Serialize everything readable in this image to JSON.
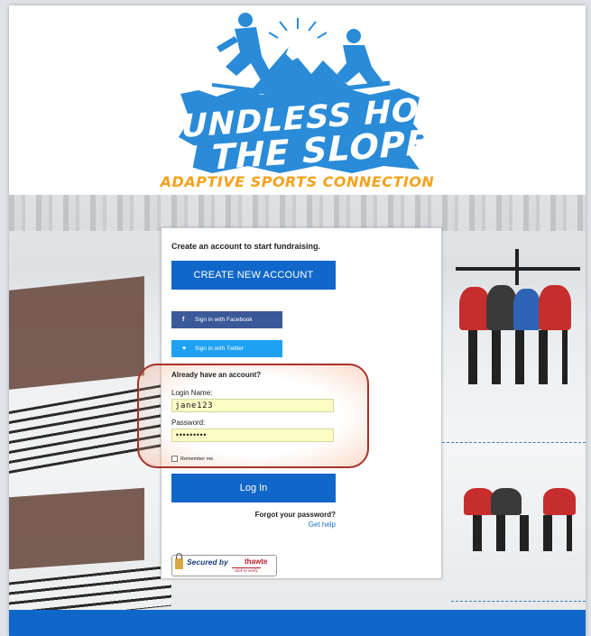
{
  "brand": {
    "logo_line1": "BOUNDLESS HOPE",
    "logo_line2": "ON THE SLOPES",
    "tagline": "ADAPTIVE SPORTS CONNECTION",
    "logo_blue": "#2a8bd8",
    "tagline_orange": "#f5a21d"
  },
  "panel": {
    "create_heading": "Create an account to start fundraising.",
    "create_button": "CREATE NEW ACCOUNT",
    "facebook_icon": "f",
    "facebook_button": "Sign in with Facebook",
    "twitter_icon": "♥",
    "twitter_button": "Sign in with Twitter",
    "login_heading": "Already have an account?",
    "login_label": "Login Name:",
    "login_value": "jane123",
    "password_label": "Password:",
    "password_value": "•••••••••",
    "remember_label": "Remember me",
    "login_button": "Log In",
    "forgot_text": "Forgot your password?",
    "help_link": "Get help",
    "accent_color": "#1167c9"
  },
  "seal": {
    "secured_by": "Secured by",
    "brand": "thawte",
    "verify": "click to verify"
  }
}
